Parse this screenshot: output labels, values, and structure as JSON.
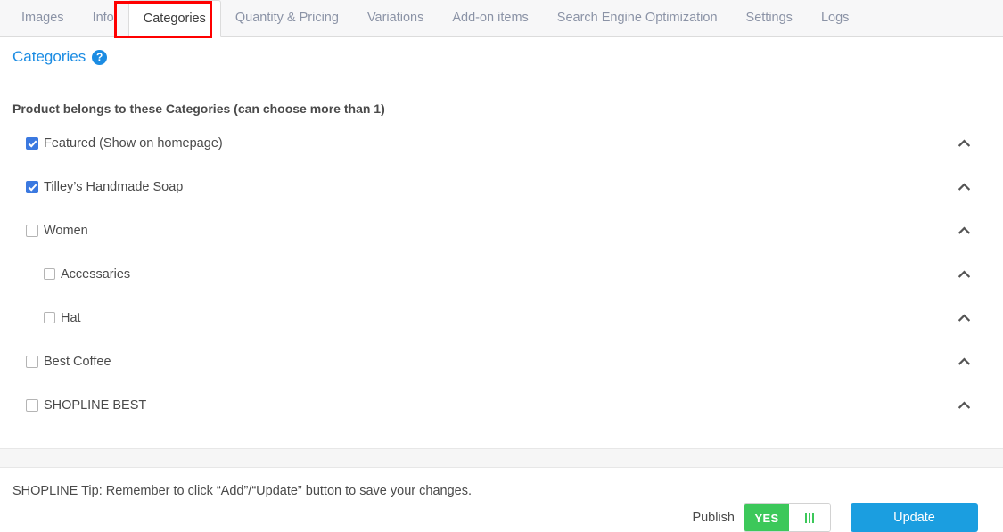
{
  "tabs": [
    {
      "label": "Images",
      "active": false
    },
    {
      "label": "Info",
      "active": false
    },
    {
      "label": "Categories",
      "active": true
    },
    {
      "label": "Quantity & Pricing",
      "active": false
    },
    {
      "label": "Variations",
      "active": false
    },
    {
      "label": "Add-on items",
      "active": false
    },
    {
      "label": "Search Engine Optimization",
      "active": false
    },
    {
      "label": "Settings",
      "active": false
    },
    {
      "label": "Logs",
      "active": false
    }
  ],
  "section": {
    "title": "Categories",
    "help_icon": "question-mark-circle-icon",
    "intro": "Product belongs to these Categories (can choose more than 1)"
  },
  "categories": [
    {
      "label": "Featured (Show on homepage)",
      "checked": true,
      "indent": 0,
      "chevron": "chevron-up-icon"
    },
    {
      "label": "Tilley’s Handmade Soap",
      "checked": true,
      "indent": 0,
      "chevron": "chevron-up-icon"
    },
    {
      "label": "Women",
      "checked": false,
      "indent": 0,
      "chevron": "chevron-up-icon"
    },
    {
      "label": "Accessaries",
      "checked": false,
      "indent": 1,
      "chevron": "chevron-up-icon"
    },
    {
      "label": "Hat",
      "checked": false,
      "indent": 1,
      "chevron": "chevron-up-icon"
    },
    {
      "label": "Best Coffee",
      "checked": false,
      "indent": 0,
      "chevron": "chevron-up-icon"
    },
    {
      "label": "SHOPLINE BEST",
      "checked": false,
      "indent": 0,
      "chevron": "chevron-up-icon"
    }
  ],
  "footer": {
    "tip": "SHOPLINE Tip: Remember to click “Add”/“Update” button to save your changes.",
    "publish_label": "Publish",
    "toggle_on_label": "YES",
    "update_label": "Update"
  },
  "colors": {
    "accent_blue": "#1b8ce3",
    "button_blue": "#1b9ee0",
    "checkbox_blue": "#3b79e0",
    "toggle_green": "#3cc85a",
    "highlight_red": "#ff0000",
    "tabbar_bg": "#f7f7f8",
    "text": "#4a4a4a",
    "tab_inactive_text": "#8b93a6"
  }
}
